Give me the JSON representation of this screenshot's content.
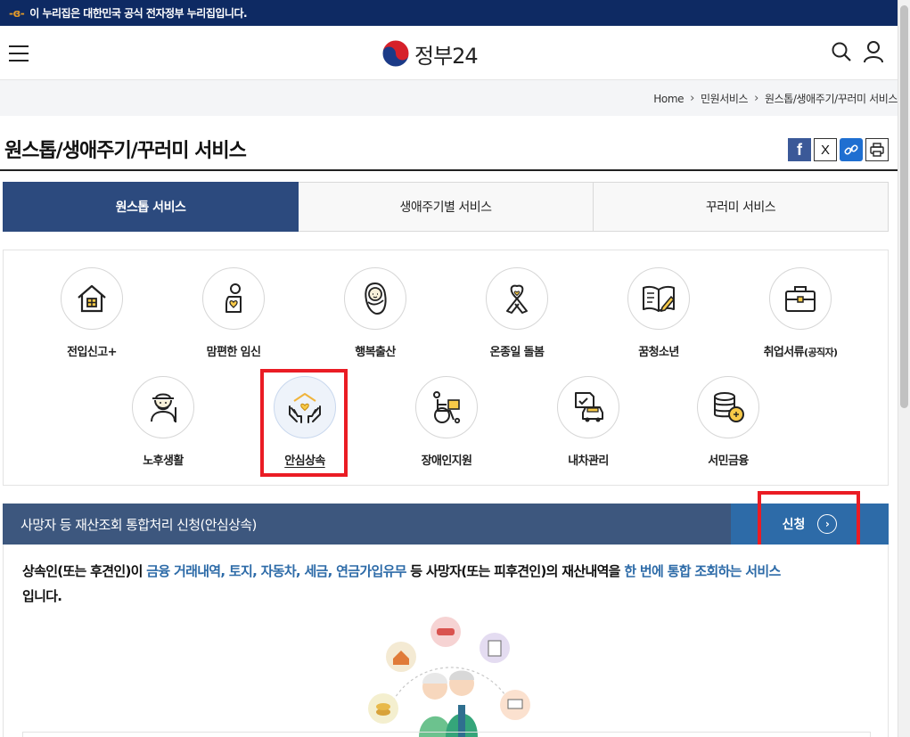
{
  "banner": {
    "text": "이 누리집은 대한민국 공식 전자정부 누리집입니다."
  },
  "header": {
    "logo_text": "정부24"
  },
  "breadcrumb": [
    "Home",
    "민원서비스",
    "원스톱/생애주기/꾸러미 서비스"
  ],
  "page_title": "원스톱/생애주기/꾸러미 서비스",
  "share": {
    "facebook": "f",
    "x": "X"
  },
  "tabs": [
    {
      "label": "원스톱 서비스",
      "active": true
    },
    {
      "label": "생애주기별 서비스",
      "active": false
    },
    {
      "label": "꾸러미 서비스",
      "active": false
    }
  ],
  "services_row1": [
    {
      "label": "전입신고+",
      "icon": "house-icon"
    },
    {
      "label": "맘편한 임신",
      "icon": "pregnancy-icon"
    },
    {
      "label": "행복출산",
      "icon": "baby-icon"
    },
    {
      "label": "온종일 돌봄",
      "icon": "ribbon-icon"
    },
    {
      "label": "꿈청소년",
      "icon": "book-icon"
    },
    {
      "label": "취업서류",
      "label_small": "(공직자)",
      "icon": "briefcase-icon"
    }
  ],
  "services_row2": [
    {
      "label": "노후생활",
      "icon": "elder-icon"
    },
    {
      "label": "안심상속",
      "icon": "hands-home-icon",
      "selected": true
    },
    {
      "label": "장애인지원",
      "icon": "wheelchair-icon"
    },
    {
      "label": "내차관리",
      "icon": "car-document-icon"
    },
    {
      "label": "서민금융",
      "icon": "coins-icon"
    }
  ],
  "service_bar": {
    "title": "사망자 등 재산조회 통합처리 신청(안심상속)",
    "apply_label": "신청"
  },
  "description": {
    "p1": "상속인(또는 후견인)이 ",
    "h1": "금융 거래내역, 토지, 자동차, 세금, 연금가입유무",
    "p2": " 등 사망자(또는 피후견인)의 재산내역을 ",
    "h2": "한 번에 통합 조회하는 서비스",
    "p3": "입니다."
  },
  "colors": {
    "banner_bg": "#0e2a63",
    "tab_active": "#2c4a7e",
    "service_bar": "#3d577e",
    "apply_button": "#2d6ba8",
    "highlight_red": "#ea1c24",
    "text_highlight": "#2d6ba8"
  }
}
